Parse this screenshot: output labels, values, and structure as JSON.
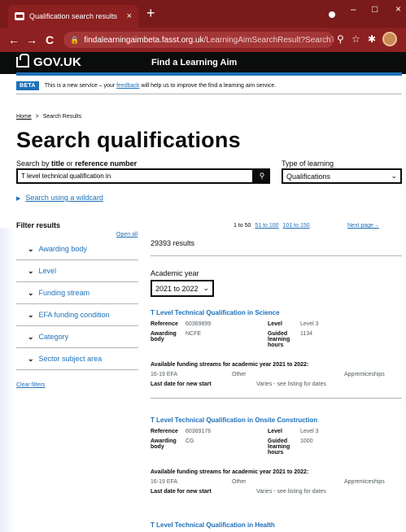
{
  "browser": {
    "tab_title": "Qualification search results",
    "tab_close": "×",
    "new_tab": "+",
    "url_host": "findalearningaimbeta.fasst.org.uk",
    "url_path": "/LearningAimSearchResult?SearchTer...",
    "back_icon": "←",
    "forward_icon": "→",
    "reload_icon": "C",
    "minimize": "–",
    "maximize": "□",
    "close": "×"
  },
  "header": {
    "logo": "GOV.UK",
    "service_name": "Find a Learning Aim"
  },
  "phase_banner": {
    "tag": "BETA",
    "text_before": "This is a new service – your",
    "link": "feedback",
    "text_after": "will help us to improve the find a learning aim service."
  },
  "breadcrumbs": {
    "home": "Home",
    "separator": ">",
    "current": "Search Results"
  },
  "page_title": "Search qualifications",
  "search": {
    "label_prefix": "Search by",
    "label_title": "title",
    "label_or": "or",
    "label_ref": "reference number",
    "value": "T level technical qualification in",
    "button_icon": "search-icon"
  },
  "type_of_learning": {
    "label": "Type of learning",
    "selected": "Qualifications"
  },
  "wildcard_link": "Search using a wildcard",
  "filters": {
    "title": "Filter results",
    "open_all": "Open all",
    "items": [
      "Awarding body",
      "Level",
      "Funding stream",
      "EFA funding condition",
      "Category",
      "Sector subject area"
    ],
    "clear": "Clear filters"
  },
  "pagination": {
    "range": "1 to 50",
    "links": [
      "51 to 100",
      "101 to 150"
    ],
    "next": "Next page"
  },
  "results_count": "29393 results",
  "academic_year": {
    "label": "Academic year",
    "selected": "2021 to 2022"
  },
  "results": [
    {
      "title": "T Level Technical Qualification in Science",
      "reference_label": "Reference",
      "reference": "60369899",
      "level_label": "Level",
      "level": "Level 3",
      "awarding_label": "Awarding body",
      "awarding": "NCFE",
      "glh_label": "Guided learning hours",
      "glh": "1134",
      "funding_head": "Available funding streams for academic year 2021 to 2022:",
      "funding": [
        "16-19 EFA",
        "Other",
        "Apprenticeships"
      ],
      "last_date_label": "Last date for new start",
      "last_date": "Varies - see listing for dates"
    },
    {
      "title": "T Level Technical Qualification in Onsite Construction",
      "reference_label": "Reference",
      "reference": "60369176",
      "level_label": "Level",
      "level": "Level 3",
      "awarding_label": "Awarding body",
      "awarding": "CG",
      "glh_label": "Guided learning hours",
      "glh": "1000",
      "funding_head": "Available funding streams for academic year 2021 to 2022:",
      "funding": [
        "16-19 EFA",
        "Other",
        "Apprenticeships"
      ],
      "last_date_label": "Last date for new start",
      "last_date": "Varies - see listing for dates"
    },
    {
      "title": "T Level Technical Qualification in Health"
    }
  ]
}
